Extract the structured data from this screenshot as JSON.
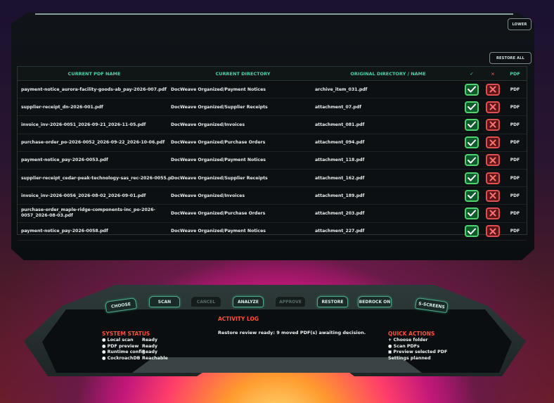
{
  "toolbar": {
    "lower_label": "LOWER",
    "restore_all_label": "RESTORE ALL"
  },
  "table": {
    "headers": [
      "CURRENT PDF NAME",
      "CURRENT DIRECTORY",
      "ORIGINAL DIRECTORY / NAME",
      "✓",
      "×",
      "PDF"
    ],
    "rows": [
      {
        "name": "payment-notice_aurora-facility-goods-ab_pay-2026-007.pdf",
        "dir": "DocWeave Organized/Payment Notices",
        "orig": "archive_item_031.pdf",
        "type": "PDF"
      },
      {
        "name": "supplier-receipt_dn-2026-001.pdf",
        "dir": "DocWeave Organized/Supplier Receipts",
        "orig": "attachment_07.pdf",
        "type": "PDF"
      },
      {
        "name": "invoice_inv-2026-0051_2026-09-21_2026-11-05.pdf",
        "dir": "DocWeave Organized/Invoices",
        "orig": "attachment_081.pdf",
        "type": "PDF"
      },
      {
        "name": "purchase-order_po-2026-0052_2026-09-22_2026-10-06.pdf",
        "dir": "DocWeave Organized/Purchase Orders",
        "orig": "attachment_094.pdf",
        "type": "PDF"
      },
      {
        "name": "payment-notice_pay-2026-0053.pdf",
        "dir": "DocWeave Organized/Payment Notices",
        "orig": "attachment_118.pdf",
        "type": "PDF"
      },
      {
        "name": "supplier-receipt_cedar-peak-technology-sas_rec-2026-0055.pdf",
        "dir": "DocWeave Organized/Supplier Receipts",
        "orig": "attachment_162.pdf",
        "type": "PDF"
      },
      {
        "name": "invoice_inv-2026-0056_2026-08-02_2026-09-01.pdf",
        "dir": "DocWeave Organized/Invoices",
        "orig": "attachment_189.pdf",
        "type": "PDF"
      },
      {
        "name": "purchase-order_maple-ridge-components-inc_po-2026-0057_2026-08-03.pdf",
        "dir": "DocWeave Organized/Purchase Orders",
        "orig": "attachment_203.pdf",
        "type": "PDF"
      },
      {
        "name": "payment-notice_pay-2026-0058.pdf",
        "dir": "DocWeave Organized/Payment Notices",
        "orig": "attachment_227.pdf",
        "type": "PDF"
      }
    ]
  },
  "console": {
    "buttons": [
      "CHOOSE",
      "SCAN",
      "CANCEL",
      "ANALYZE",
      "APPROVE",
      "RESTORE",
      "BEDROCK ON",
      "S-SCREENS"
    ],
    "activity_title": "ACTIVITY LOG",
    "activity_message": "Restore review ready: 9 moved PDF(s) awaiting decision.",
    "system_status_title": "SYSTEM STATUS",
    "system_status": [
      {
        "label": "● Local scan",
        "value": "Ready"
      },
      {
        "label": "● PDF preview",
        "value": "Ready"
      },
      {
        "label": "● Runtime config",
        "value": "Ready"
      },
      {
        "label": "● CockroachDB",
        "value": "Reachable"
      }
    ],
    "quick_actions_title": "QUICK ACTIONS",
    "quick_actions": [
      "+ Choose folder",
      "● Scan PDFs",
      "◼ Preview selected PDF",
      "Settings planned"
    ]
  },
  "colors": {
    "accent": "#4fd3a6",
    "approve": "#4fd36f",
    "reject": "#e05050",
    "alert": "#ff5040"
  }
}
